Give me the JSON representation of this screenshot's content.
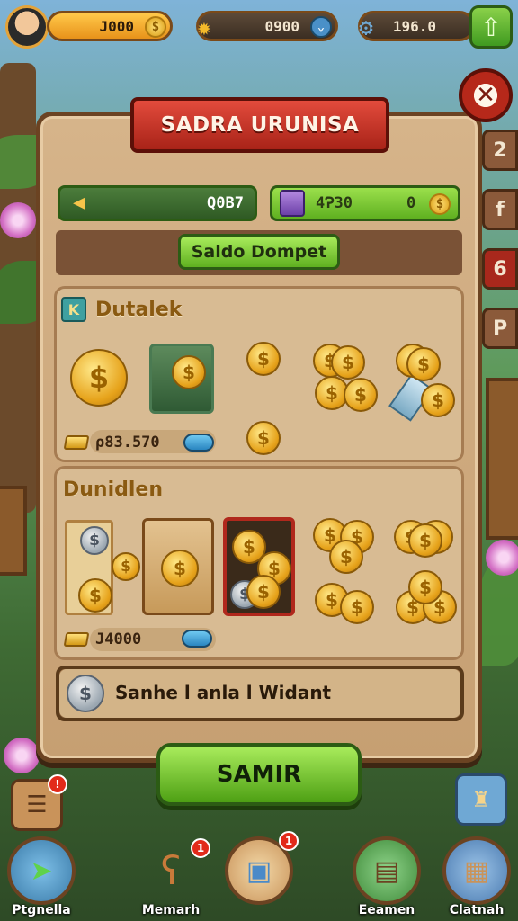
{
  "top_bar": {
    "gold": "J000",
    "gems": "0900",
    "keys": "196.0"
  },
  "panel": {
    "title": "SADRA URUNISA",
    "side_tabs": [
      "2",
      "f",
      "6",
      "P"
    ],
    "resource_left": "Q0B7",
    "resource_right_a": "4Ɂ30",
    "resource_right_b": "0",
    "wallet_button": "Saldo Dompet",
    "section1": {
      "title": "Dutalek",
      "badge": "K",
      "amount": "ρ83.570"
    },
    "section2": {
      "title": "Dunidlen",
      "amount": "J4000"
    },
    "info_text": "Sanhe l anla l Widant"
  },
  "confirm_button": "SAMIR",
  "bottom_nav": [
    {
      "label": "Ptgnella",
      "icon": "arrow-icon"
    },
    {
      "label": "Memarh",
      "icon": "bear-icon",
      "badge": "1"
    },
    {
      "label": "",
      "icon": "chest-icon",
      "badge": "1"
    },
    {
      "label": "Eeamen",
      "icon": "box-icon"
    },
    {
      "label": "Clatnah",
      "icon": "crate-icon"
    }
  ],
  "colors": {
    "panel": "#d6b48a",
    "banner": "#c9372a",
    "primary_button": "#6fc426",
    "gold": "#e8a21a"
  }
}
